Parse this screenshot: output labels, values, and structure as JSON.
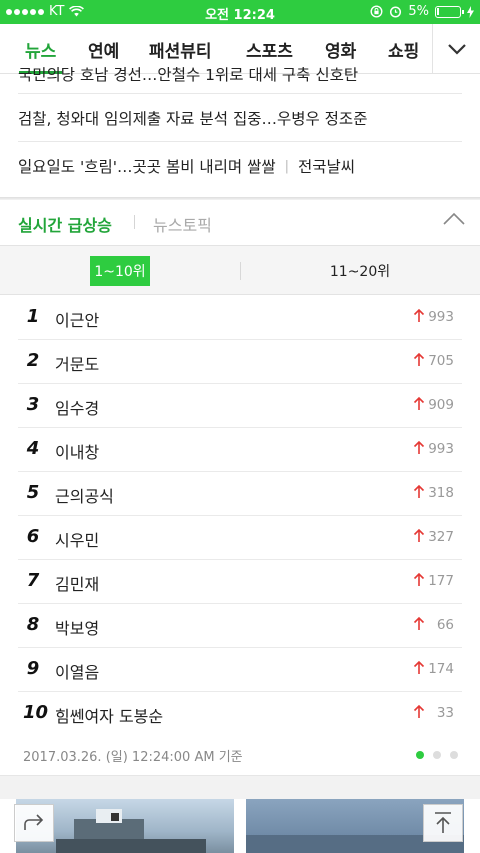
{
  "status": {
    "carrier": "KT",
    "time": "오전 12:24",
    "battery": "5%"
  },
  "tabs": [
    {
      "label": "뉴스",
      "active": true
    },
    {
      "label": "연예"
    },
    {
      "label": "패션뷰티"
    },
    {
      "label": "스포츠"
    },
    {
      "label": "영화"
    },
    {
      "label": "쇼핑"
    }
  ],
  "headlines": [
    {
      "text": "국민의당 호남 경선…안철수 1위로 대세 구축 신호탄"
    },
    {
      "text": "검찰, 청와대 임의제출 자료 분석 집중…우병우 정조준"
    },
    {
      "text": "일요일도 '흐림'…곳곳 봄비 내리며 쌀쌀",
      "tag": "전국날씨"
    }
  ],
  "realtime": {
    "tab_active": "실시간 급상승",
    "tab_inactive": "뉴스토픽",
    "segment_1": "1~10위",
    "segment_2": "11~20위",
    "items": [
      {
        "rank": "1",
        "keyword": "이근안",
        "count": "993"
      },
      {
        "rank": "2",
        "keyword": "거문도",
        "count": "705"
      },
      {
        "rank": "3",
        "keyword": "임수경",
        "count": "909"
      },
      {
        "rank": "4",
        "keyword": "이내창",
        "count": "993"
      },
      {
        "rank": "5",
        "keyword": "근의공식",
        "count": "318"
      },
      {
        "rank": "6",
        "keyword": "시우민",
        "count": "327"
      },
      {
        "rank": "7",
        "keyword": "김민재",
        "count": "177"
      },
      {
        "rank": "8",
        "keyword": "박보영",
        "count": "66"
      },
      {
        "rank": "9",
        "keyword": "이열음",
        "count": "174"
      },
      {
        "rank": "10",
        "keyword": "힘쎈여자 도봉순",
        "count": "33"
      }
    ],
    "timestamp": "2017.03.26. (일) 12:24:00 AM 기준",
    "page_count": 3,
    "active_page": 1
  },
  "colors": {
    "accent": "#2ecc40",
    "accent_text": "#22a53a",
    "rise_arrow": "#e53935"
  }
}
